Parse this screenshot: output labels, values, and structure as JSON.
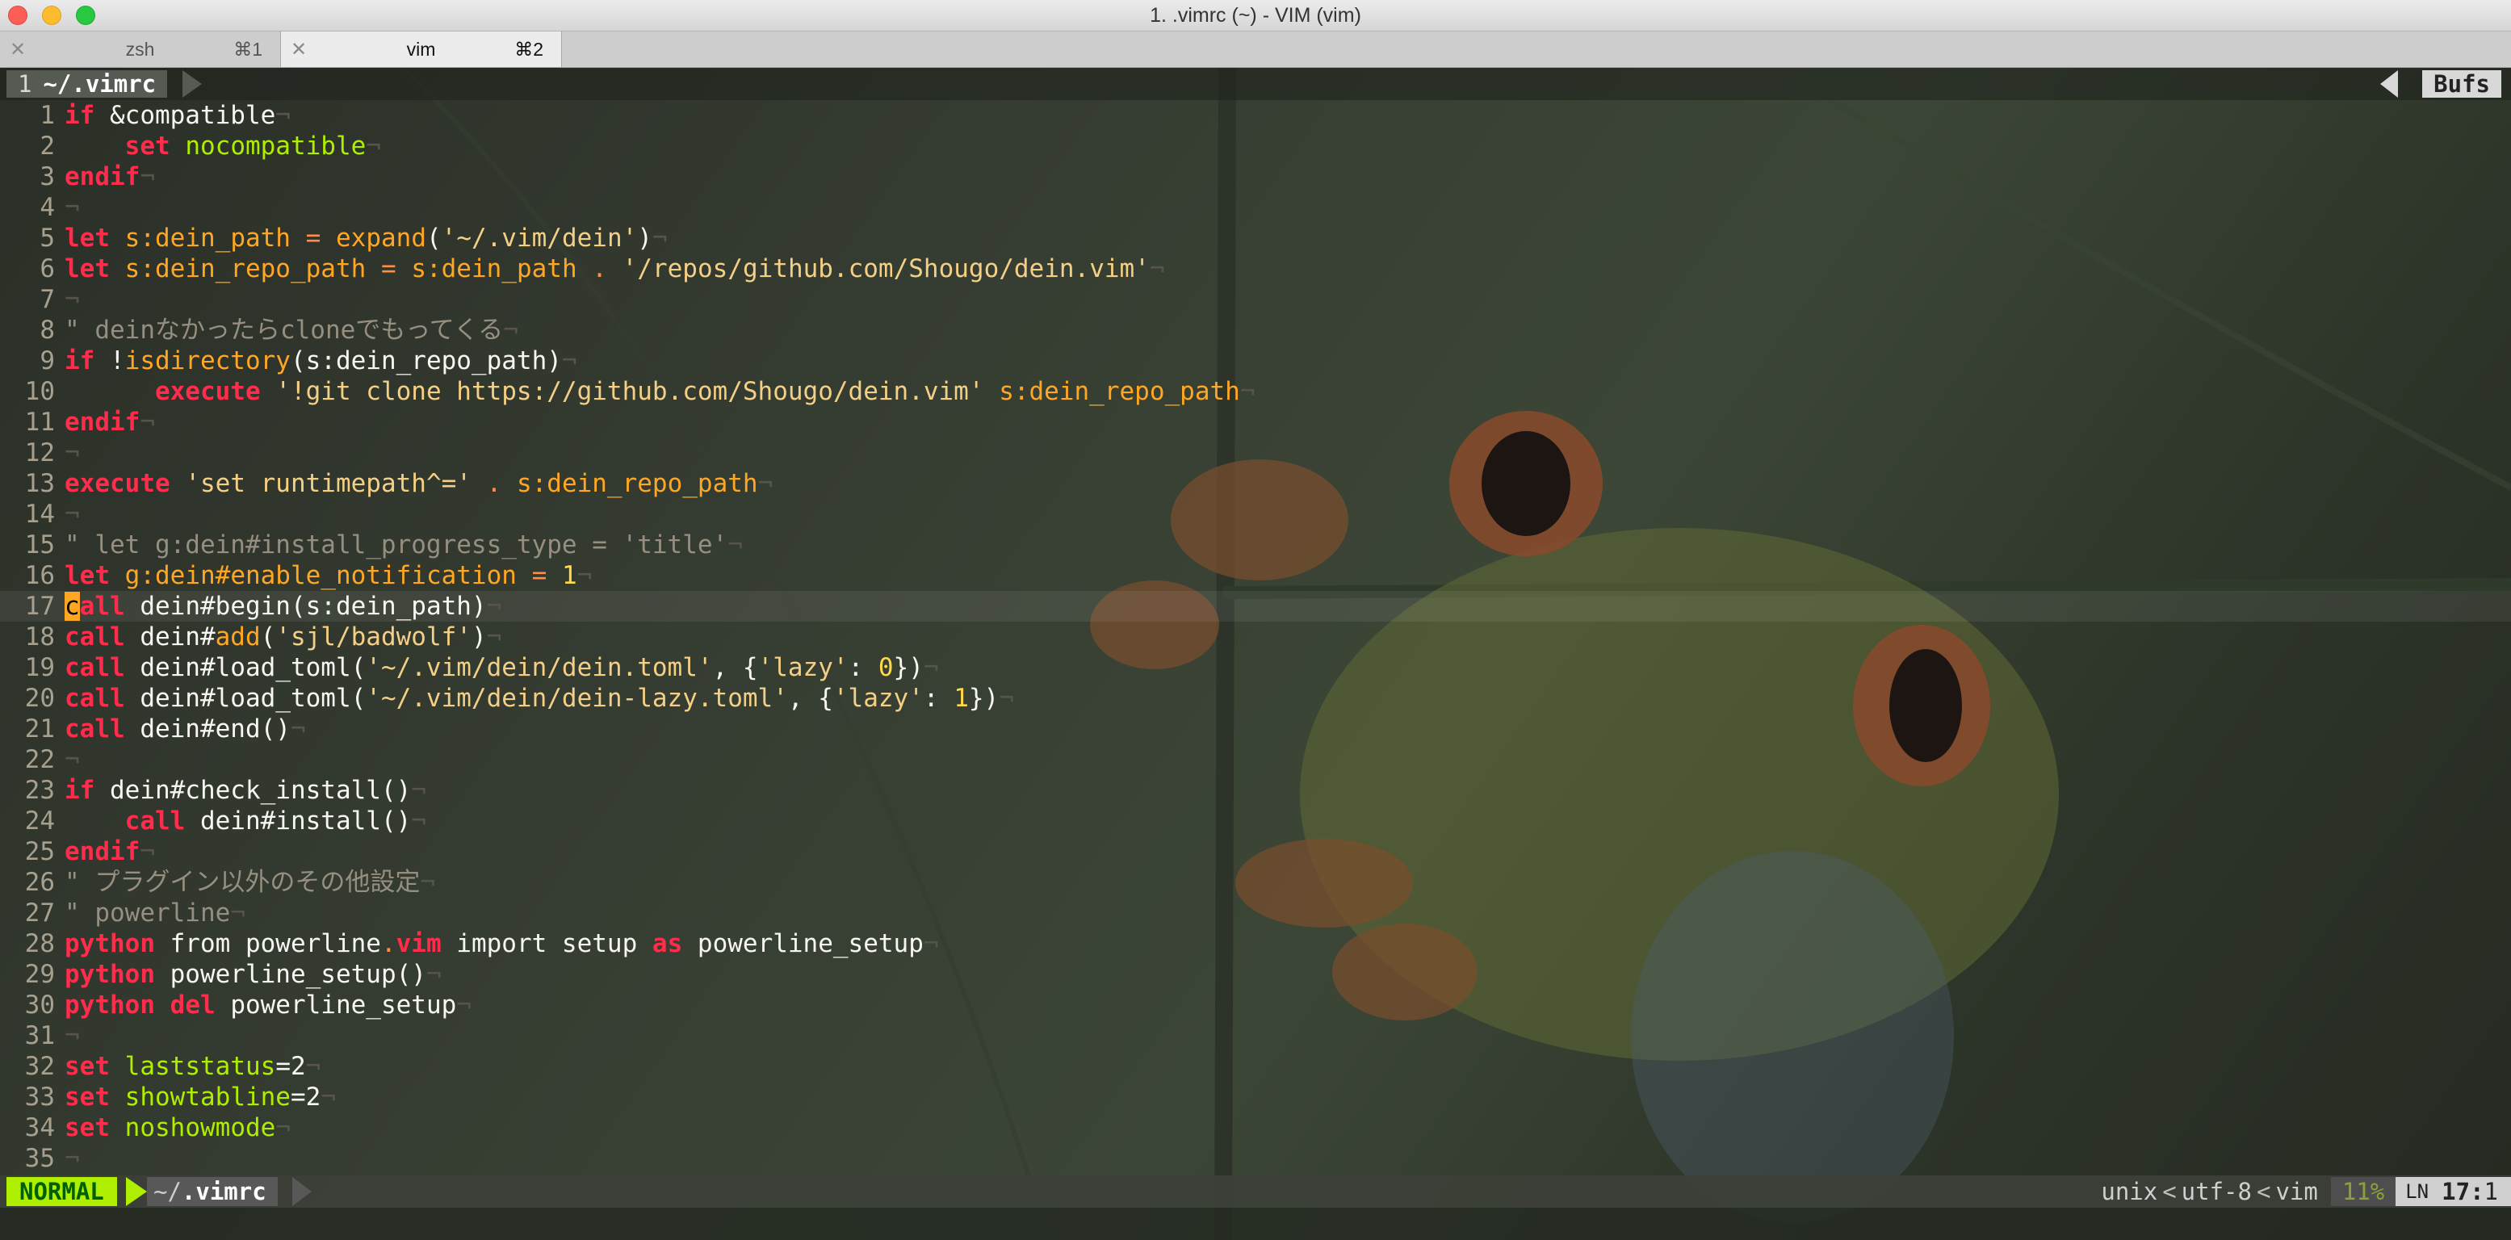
{
  "window": {
    "title": "1. .vimrc (~) - VIM (vim)"
  },
  "tabs": [
    {
      "name": "zsh",
      "shortcut": "⌘1",
      "active": false
    },
    {
      "name": "vim",
      "shortcut": "⌘2",
      "active": true
    }
  ],
  "bufferline": {
    "number": "1",
    "name": "~/.vimrc",
    "bufs_label": "Bufs"
  },
  "lines": [
    {
      "n": "1",
      "t": [
        [
          "kw",
          "if"
        ],
        [
          "tx",
          " &compatible"
        ]
      ]
    },
    {
      "n": "2",
      "t": [
        [
          "tx",
          "    "
        ],
        [
          "kw",
          "set"
        ],
        [
          "tx",
          " "
        ],
        [
          "opt",
          "nocompatible"
        ]
      ]
    },
    {
      "n": "3",
      "t": [
        [
          "kw",
          "endif"
        ]
      ]
    },
    {
      "n": "4",
      "t": []
    },
    {
      "n": "5",
      "t": [
        [
          "kw",
          "let"
        ],
        [
          "tx",
          " "
        ],
        [
          "id",
          "s:dein_path"
        ],
        [
          "tx",
          " "
        ],
        [
          "op",
          "="
        ],
        [
          "tx",
          " "
        ],
        [
          "fn",
          "expand"
        ],
        [
          "tx",
          "("
        ],
        [
          "str",
          "'~/.vim/dein'"
        ],
        [
          "tx",
          ")"
        ]
      ]
    },
    {
      "n": "6",
      "t": [
        [
          "kw",
          "let"
        ],
        [
          "tx",
          " "
        ],
        [
          "id",
          "s:dein_repo_path"
        ],
        [
          "tx",
          " "
        ],
        [
          "op",
          "="
        ],
        [
          "tx",
          " "
        ],
        [
          "id",
          "s:dein_path"
        ],
        [
          "tx",
          " "
        ],
        [
          "op",
          "."
        ],
        [
          "tx",
          " "
        ],
        [
          "str",
          "'/repos/github.com/Shougo/dein.vim'"
        ]
      ]
    },
    {
      "n": "7",
      "t": []
    },
    {
      "n": "8",
      "t": [
        [
          "cm",
          "\" deinなかったらcloneでもってくる"
        ]
      ]
    },
    {
      "n": "9",
      "t": [
        [
          "kw",
          "if"
        ],
        [
          "tx",
          " !"
        ],
        [
          "fn",
          "isdirectory"
        ],
        [
          "tx",
          "(s:dein_repo_path)"
        ]
      ]
    },
    {
      "n": "10",
      "t": [
        [
          "tx",
          "      "
        ],
        [
          "kw",
          "execute"
        ],
        [
          "tx",
          " "
        ],
        [
          "str",
          "'!git clone https://github.com/Shougo/dein.vim'"
        ],
        [
          "tx",
          " "
        ],
        [
          "id",
          "s:dein_repo_path"
        ]
      ]
    },
    {
      "n": "11",
      "t": [
        [
          "kw",
          "endif"
        ]
      ]
    },
    {
      "n": "12",
      "t": []
    },
    {
      "n": "13",
      "t": [
        [
          "kw",
          "execute"
        ],
        [
          "tx",
          " "
        ],
        [
          "str",
          "'set runtimepath^='"
        ],
        [
          "tx",
          " "
        ],
        [
          "op",
          "."
        ],
        [
          "tx",
          " "
        ],
        [
          "id",
          "s:dein_repo_path"
        ]
      ]
    },
    {
      "n": "14",
      "t": []
    },
    {
      "n": "15",
      "t": [
        [
          "cm",
          "\" let g:dein#install_progress_type = 'title'"
        ]
      ]
    },
    {
      "n": "16",
      "t": [
        [
          "kw",
          "let"
        ],
        [
          "tx",
          " "
        ],
        [
          "id",
          "g:dein#enable_notification"
        ],
        [
          "tx",
          " "
        ],
        [
          "op",
          "="
        ],
        [
          "tx",
          " "
        ],
        [
          "num",
          "1"
        ]
      ]
    },
    {
      "n": "17",
      "t": [
        [
          "cursor",
          "c"
        ],
        [
          "kw",
          "all"
        ],
        [
          "tx",
          " dein#begin(s:dein_path)"
        ]
      ]
    },
    {
      "n": "18",
      "t": [
        [
          "kw",
          "call"
        ],
        [
          "tx",
          " dein#"
        ],
        [
          "fn",
          "add"
        ],
        [
          "tx",
          "("
        ],
        [
          "str",
          "'sjl/badwolf'"
        ],
        [
          "tx",
          ")"
        ]
      ]
    },
    {
      "n": "19",
      "t": [
        [
          "kw",
          "call"
        ],
        [
          "tx",
          " dein#load_toml("
        ],
        [
          "str",
          "'~/.vim/dein/dein.toml'"
        ],
        [
          "tx",
          ", {"
        ],
        [
          "str",
          "'lazy'"
        ],
        [
          "tx",
          ": "
        ],
        [
          "num",
          "0"
        ],
        [
          "tx",
          "})"
        ]
      ]
    },
    {
      "n": "20",
      "t": [
        [
          "kw",
          "call"
        ],
        [
          "tx",
          " dein#load_toml("
        ],
        [
          "str",
          "'~/.vim/dein/dein-lazy.toml'"
        ],
        [
          "tx",
          ", {"
        ],
        [
          "str",
          "'lazy'"
        ],
        [
          "tx",
          ": "
        ],
        [
          "num",
          "1"
        ],
        [
          "tx",
          "})"
        ]
      ]
    },
    {
      "n": "21",
      "t": [
        [
          "kw",
          "call"
        ],
        [
          "tx",
          " dein#end()"
        ]
      ]
    },
    {
      "n": "22",
      "t": []
    },
    {
      "n": "23",
      "t": [
        [
          "kw",
          "if"
        ],
        [
          "tx",
          " dein#check_install()"
        ]
      ]
    },
    {
      "n": "24",
      "t": [
        [
          "tx",
          "    "
        ],
        [
          "kw",
          "call"
        ],
        [
          "tx",
          " dein#install()"
        ]
      ]
    },
    {
      "n": "25",
      "t": [
        [
          "kw",
          "endif"
        ]
      ]
    },
    {
      "n": "26",
      "t": [
        [
          "cm",
          "\" プラグイン以外のその他設定"
        ]
      ]
    },
    {
      "n": "27",
      "t": [
        [
          "cm",
          "\" powerline"
        ]
      ]
    },
    {
      "n": "28",
      "t": [
        [
          "kw",
          "python"
        ],
        [
          "tx",
          " from powerline"
        ],
        [
          "op",
          "."
        ],
        [
          "kw",
          "vim"
        ],
        [
          "tx",
          " import setup "
        ],
        [
          "kw",
          "as"
        ],
        [
          "tx",
          " powerline_setup"
        ]
      ]
    },
    {
      "n": "29",
      "t": [
        [
          "kw",
          "python"
        ],
        [
          "tx",
          " powerline_setup()"
        ]
      ]
    },
    {
      "n": "30",
      "t": [
        [
          "kw",
          "python"
        ],
        [
          "tx",
          " "
        ],
        [
          "kw",
          "del"
        ],
        [
          "tx",
          " powerline_setup"
        ]
      ]
    },
    {
      "n": "31",
      "t": []
    },
    {
      "n": "32",
      "t": [
        [
          "kw",
          "set"
        ],
        [
          "tx",
          " "
        ],
        [
          "opt",
          "laststatus"
        ],
        [
          "tx",
          "=2"
        ]
      ]
    },
    {
      "n": "33",
      "t": [
        [
          "kw",
          "set"
        ],
        [
          "tx",
          " "
        ],
        [
          "opt",
          "showtabline"
        ],
        [
          "tx",
          "=2"
        ]
      ]
    },
    {
      "n": "34",
      "t": [
        [
          "kw",
          "set"
        ],
        [
          "tx",
          " "
        ],
        [
          "opt",
          "noshowmode"
        ]
      ]
    },
    {
      "n": "35",
      "t": []
    }
  ],
  "eol_char": "¬",
  "statusline": {
    "mode": "NORMAL",
    "dir": "~/",
    "file": ".vimrc",
    "fileformat": "unix",
    "encoding": "utf-8",
    "filetype": "vim",
    "percent": "11%",
    "ln_icon": "LN",
    "line": "17",
    "col": "1"
  },
  "colors": {
    "keyword": "#ff2c4b",
    "identifier": "#ffa724",
    "string": "#f4cf86",
    "comment": "#968f80",
    "option": "#aeee00",
    "mode_bg": "#aeee00"
  }
}
